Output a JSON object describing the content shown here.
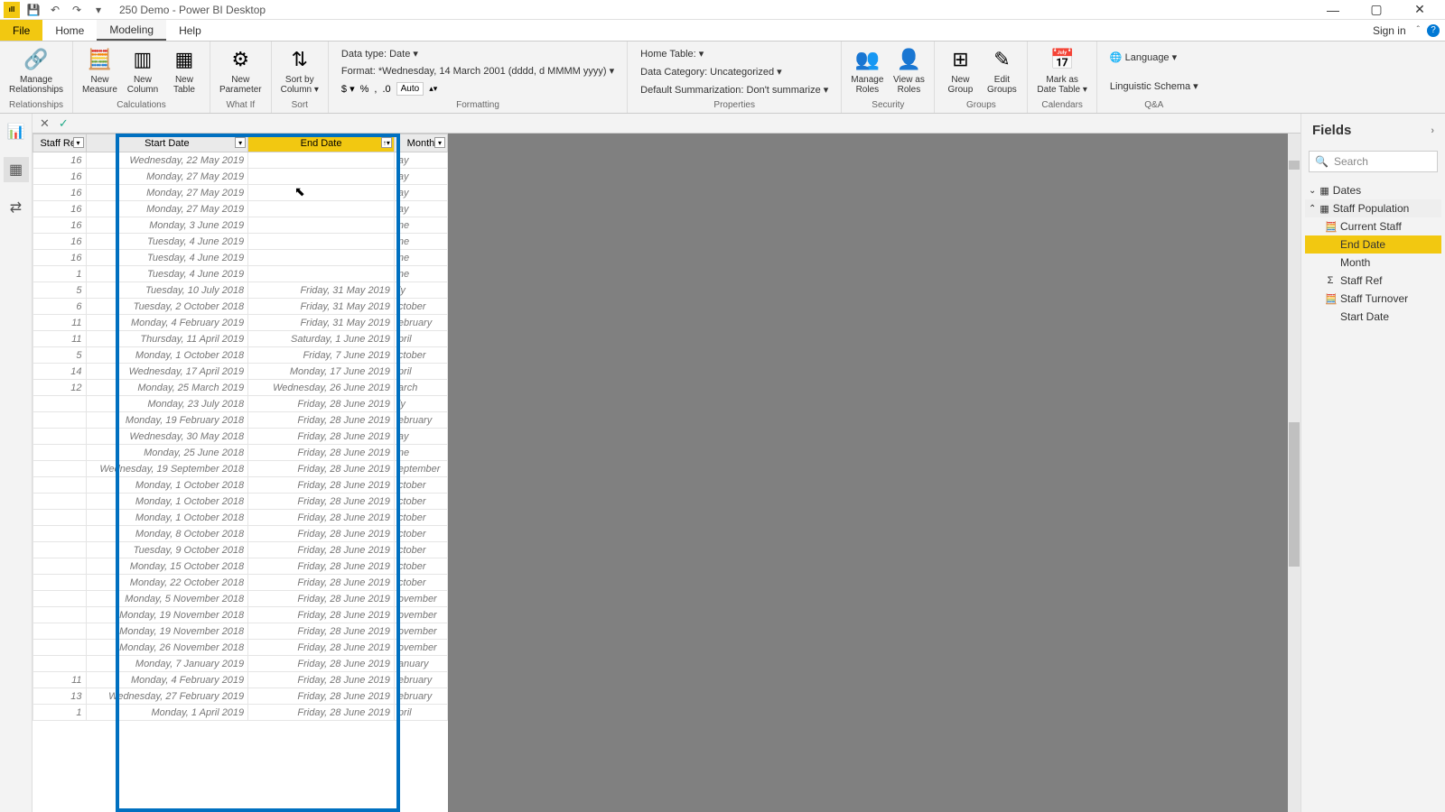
{
  "title": "250 Demo - Power BI Desktop",
  "qat": {
    "save": "💾",
    "undo": "↶",
    "redo": "↷",
    "more": "▾"
  },
  "menu": {
    "file": "File",
    "home": "Home",
    "modeling": "Modeling",
    "help": "Help",
    "signin": "Sign in"
  },
  "ribbon": {
    "relationships": {
      "manage": "Manage\nRelationships",
      "group": "Relationships"
    },
    "calc": {
      "measure": "New\nMeasure",
      "column": "New\nColumn",
      "table": "New\nTable",
      "group": "Calculations"
    },
    "whatif": {
      "param": "New\nParameter",
      "group": "What If"
    },
    "sort": {
      "btn": "Sort by\nColumn ▾",
      "group": "Sort"
    },
    "formatting": {
      "datatype": "Data type: Date ▾",
      "format": "Format: *Wednesday, 14 March 2001 (dddd, d MMMM yyyy) ▾",
      "currency": "$ ▾",
      "pct": "%",
      "comma": ",",
      "dec": ".0",
      "auto": "Auto",
      "group": "Formatting"
    },
    "properties": {
      "hometable": "Home Table: ▾",
      "datacat": "Data Category: Uncategorized ▾",
      "summ": "Default Summarization: Don't summarize ▾",
      "group": "Properties"
    },
    "security": {
      "manage": "Manage\nRoles",
      "view": "View as\nRoles",
      "group": "Security"
    },
    "groups": {
      "new": "New\nGroup",
      "edit": "Edit\nGroups",
      "group": "Groups"
    },
    "calendars": {
      "mark": "Mark as\nDate Table ▾",
      "group": "Calendars"
    },
    "qa": {
      "lang": "🌐 Language ▾",
      "ling": "Linguistic Schema ▾",
      "group": "Q&A"
    }
  },
  "columns": {
    "staffref": "Staff Ref",
    "start": "Start Date",
    "end": "End Date",
    "month": "Month"
  },
  "rows": [
    {
      "r": "16",
      "s": "Wednesday, 22 May 2019",
      "e": "",
      "m": "ay"
    },
    {
      "r": "16",
      "s": "Monday, 27 May 2019",
      "e": "",
      "m": "ay"
    },
    {
      "r": "16",
      "s": "Monday, 27 May 2019",
      "e": "",
      "m": "ay"
    },
    {
      "r": "16",
      "s": "Monday, 27 May 2019",
      "e": "",
      "m": "ay"
    },
    {
      "r": "16",
      "s": "Monday, 3 June 2019",
      "e": "",
      "m": "ne"
    },
    {
      "r": "16",
      "s": "Tuesday, 4 June 2019",
      "e": "",
      "m": "ne"
    },
    {
      "r": "16",
      "s": "Tuesday, 4 June 2019",
      "e": "",
      "m": "ne"
    },
    {
      "r": "1",
      "s": "Tuesday, 4 June 2019",
      "e": "",
      "m": "ne"
    },
    {
      "r": "5",
      "s": "Tuesday, 10 July 2018",
      "e": "Friday, 31 May 2019",
      "m": "ly"
    },
    {
      "r": "6",
      "s": "Tuesday, 2 October 2018",
      "e": "Friday, 31 May 2019",
      "m": "ctober"
    },
    {
      "r": "11",
      "s": "Monday, 4 February 2019",
      "e": "Friday, 31 May 2019",
      "m": "ebruary"
    },
    {
      "r": "11",
      "s": "Thursday, 11 April 2019",
      "e": "Saturday, 1 June 2019",
      "m": "pril"
    },
    {
      "r": "5",
      "s": "Monday, 1 October 2018",
      "e": "Friday, 7 June 2019",
      "m": "ctober"
    },
    {
      "r": "14",
      "s": "Wednesday, 17 April 2019",
      "e": "Monday, 17 June 2019",
      "m": "pril"
    },
    {
      "r": "12",
      "s": "Monday, 25 March 2019",
      "e": "Wednesday, 26 June 2019",
      "m": "arch"
    },
    {
      "r": "",
      "s": "Monday, 23 July 2018",
      "e": "Friday, 28 June 2019",
      "m": "ly"
    },
    {
      "r": "",
      "s": "Monday, 19 February 2018",
      "e": "Friday, 28 June 2019",
      "m": "ebruary"
    },
    {
      "r": "",
      "s": "Wednesday, 30 May 2018",
      "e": "Friday, 28 June 2019",
      "m": "ay"
    },
    {
      "r": "",
      "s": "Monday, 25 June 2018",
      "e": "Friday, 28 June 2019",
      "m": "ne"
    },
    {
      "r": "",
      "s": "Wednesday, 19 September 2018",
      "e": "Friday, 28 June 2019",
      "m": "eptember"
    },
    {
      "r": "",
      "s": "Monday, 1 October 2018",
      "e": "Friday, 28 June 2019",
      "m": "ctober"
    },
    {
      "r": "",
      "s": "Monday, 1 October 2018",
      "e": "Friday, 28 June 2019",
      "m": "ctober"
    },
    {
      "r": "",
      "s": "Monday, 1 October 2018",
      "e": "Friday, 28 June 2019",
      "m": "ctober"
    },
    {
      "r": "",
      "s": "Monday, 8 October 2018",
      "e": "Friday, 28 June 2019",
      "m": "ctober"
    },
    {
      "r": "",
      "s": "Tuesday, 9 October 2018",
      "e": "Friday, 28 June 2019",
      "m": "ctober"
    },
    {
      "r": "",
      "s": "Monday, 15 October 2018",
      "e": "Friday, 28 June 2019",
      "m": "ctober"
    },
    {
      "r": "",
      "s": "Monday, 22 October 2018",
      "e": "Friday, 28 June 2019",
      "m": "ctober"
    },
    {
      "r": "",
      "s": "Monday, 5 November 2018",
      "e": "Friday, 28 June 2019",
      "m": "ovember"
    },
    {
      "r": "",
      "s": "Monday, 19 November 2018",
      "e": "Friday, 28 June 2019",
      "m": "ovember"
    },
    {
      "r": "",
      "s": "Monday, 19 November 2018",
      "e": "Friday, 28 June 2019",
      "m": "ovember"
    },
    {
      "r": "",
      "s": "Monday, 26 November 2018",
      "e": "Friday, 28 June 2019",
      "m": "ovember"
    },
    {
      "r": "",
      "s": "Monday, 7 January 2019",
      "e": "Friday, 28 June 2019",
      "m": "anuary"
    },
    {
      "r": "11",
      "s": "Monday, 4 February 2019",
      "e": "Friday, 28 June 2019",
      "m": "ebruary"
    },
    {
      "r": "13",
      "s": "Wednesday, 27 February 2019",
      "e": "Friday, 28 June 2019",
      "m": "ebruary"
    },
    {
      "r": "1",
      "s": "Monday, 1 April 2019",
      "e": "Friday, 28 June 2019",
      "m": "pril"
    }
  ],
  "fields": {
    "title": "Fields",
    "search": "Search",
    "tables": {
      "dates": "Dates",
      "staffpop": "Staff Population"
    },
    "items": {
      "current": "Current Staff",
      "end": "End Date",
      "month": "Month",
      "staffref": "Staff Ref",
      "turnover": "Staff Turnover",
      "start": "Start Date"
    }
  }
}
